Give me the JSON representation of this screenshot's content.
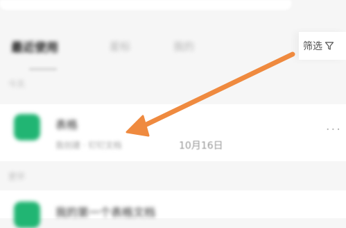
{
  "tabs": {
    "items": [
      "最近使用",
      "星标",
      "我的"
    ]
  },
  "filter": {
    "label": "筛选",
    "icon": "funnel-icon"
  },
  "sections": {
    "first": "今天",
    "second": "更早"
  },
  "files": [
    {
      "name": "表格",
      "meta": "我创建 · 钉钉文档",
      "date": "10月16日",
      "icon": "spreadsheet-icon"
    },
    {
      "name": "我的第一个表格文档",
      "icon": "spreadsheet-icon"
    }
  ],
  "more_icon": "more-icon",
  "arrow": {
    "color": "#ef8a3f",
    "icon": "annotation-arrow"
  }
}
